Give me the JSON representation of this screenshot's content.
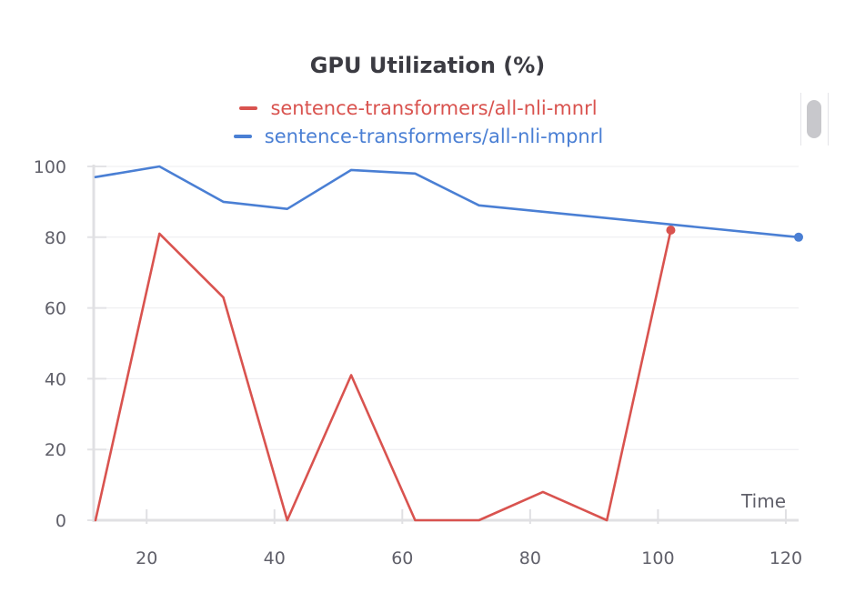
{
  "chart_data": {
    "type": "line",
    "title": "GPU Utilization (%)",
    "xlabel": "Time",
    "ylabel": "",
    "xlim": [
      10,
      122
    ],
    "ylim": [
      0,
      100
    ],
    "x_ticks": [
      20,
      40,
      60,
      80,
      100,
      120
    ],
    "y_ticks": [
      0,
      20,
      40,
      60,
      80,
      100
    ],
    "grid": true,
    "legend_position": "top-center",
    "series": [
      {
        "name": "sentence-transformers/all-nli-mnrl",
        "color": "#d9534f",
        "x": [
          12,
          22,
          32,
          42,
          52,
          62,
          72,
          82,
          92,
          102
        ],
        "y": [
          0,
          81,
          63,
          0,
          41,
          0,
          0,
          8,
          0,
          82
        ]
      },
      {
        "name": "sentence-transformers/all-nli-mpnrl",
        "color": "#4a7fd4",
        "x": [
          12,
          22,
          32,
          42,
          52,
          62,
          72,
          122
        ],
        "y": [
          97,
          100,
          90,
          88,
          99,
          98,
          89,
          80
        ]
      }
    ]
  }
}
